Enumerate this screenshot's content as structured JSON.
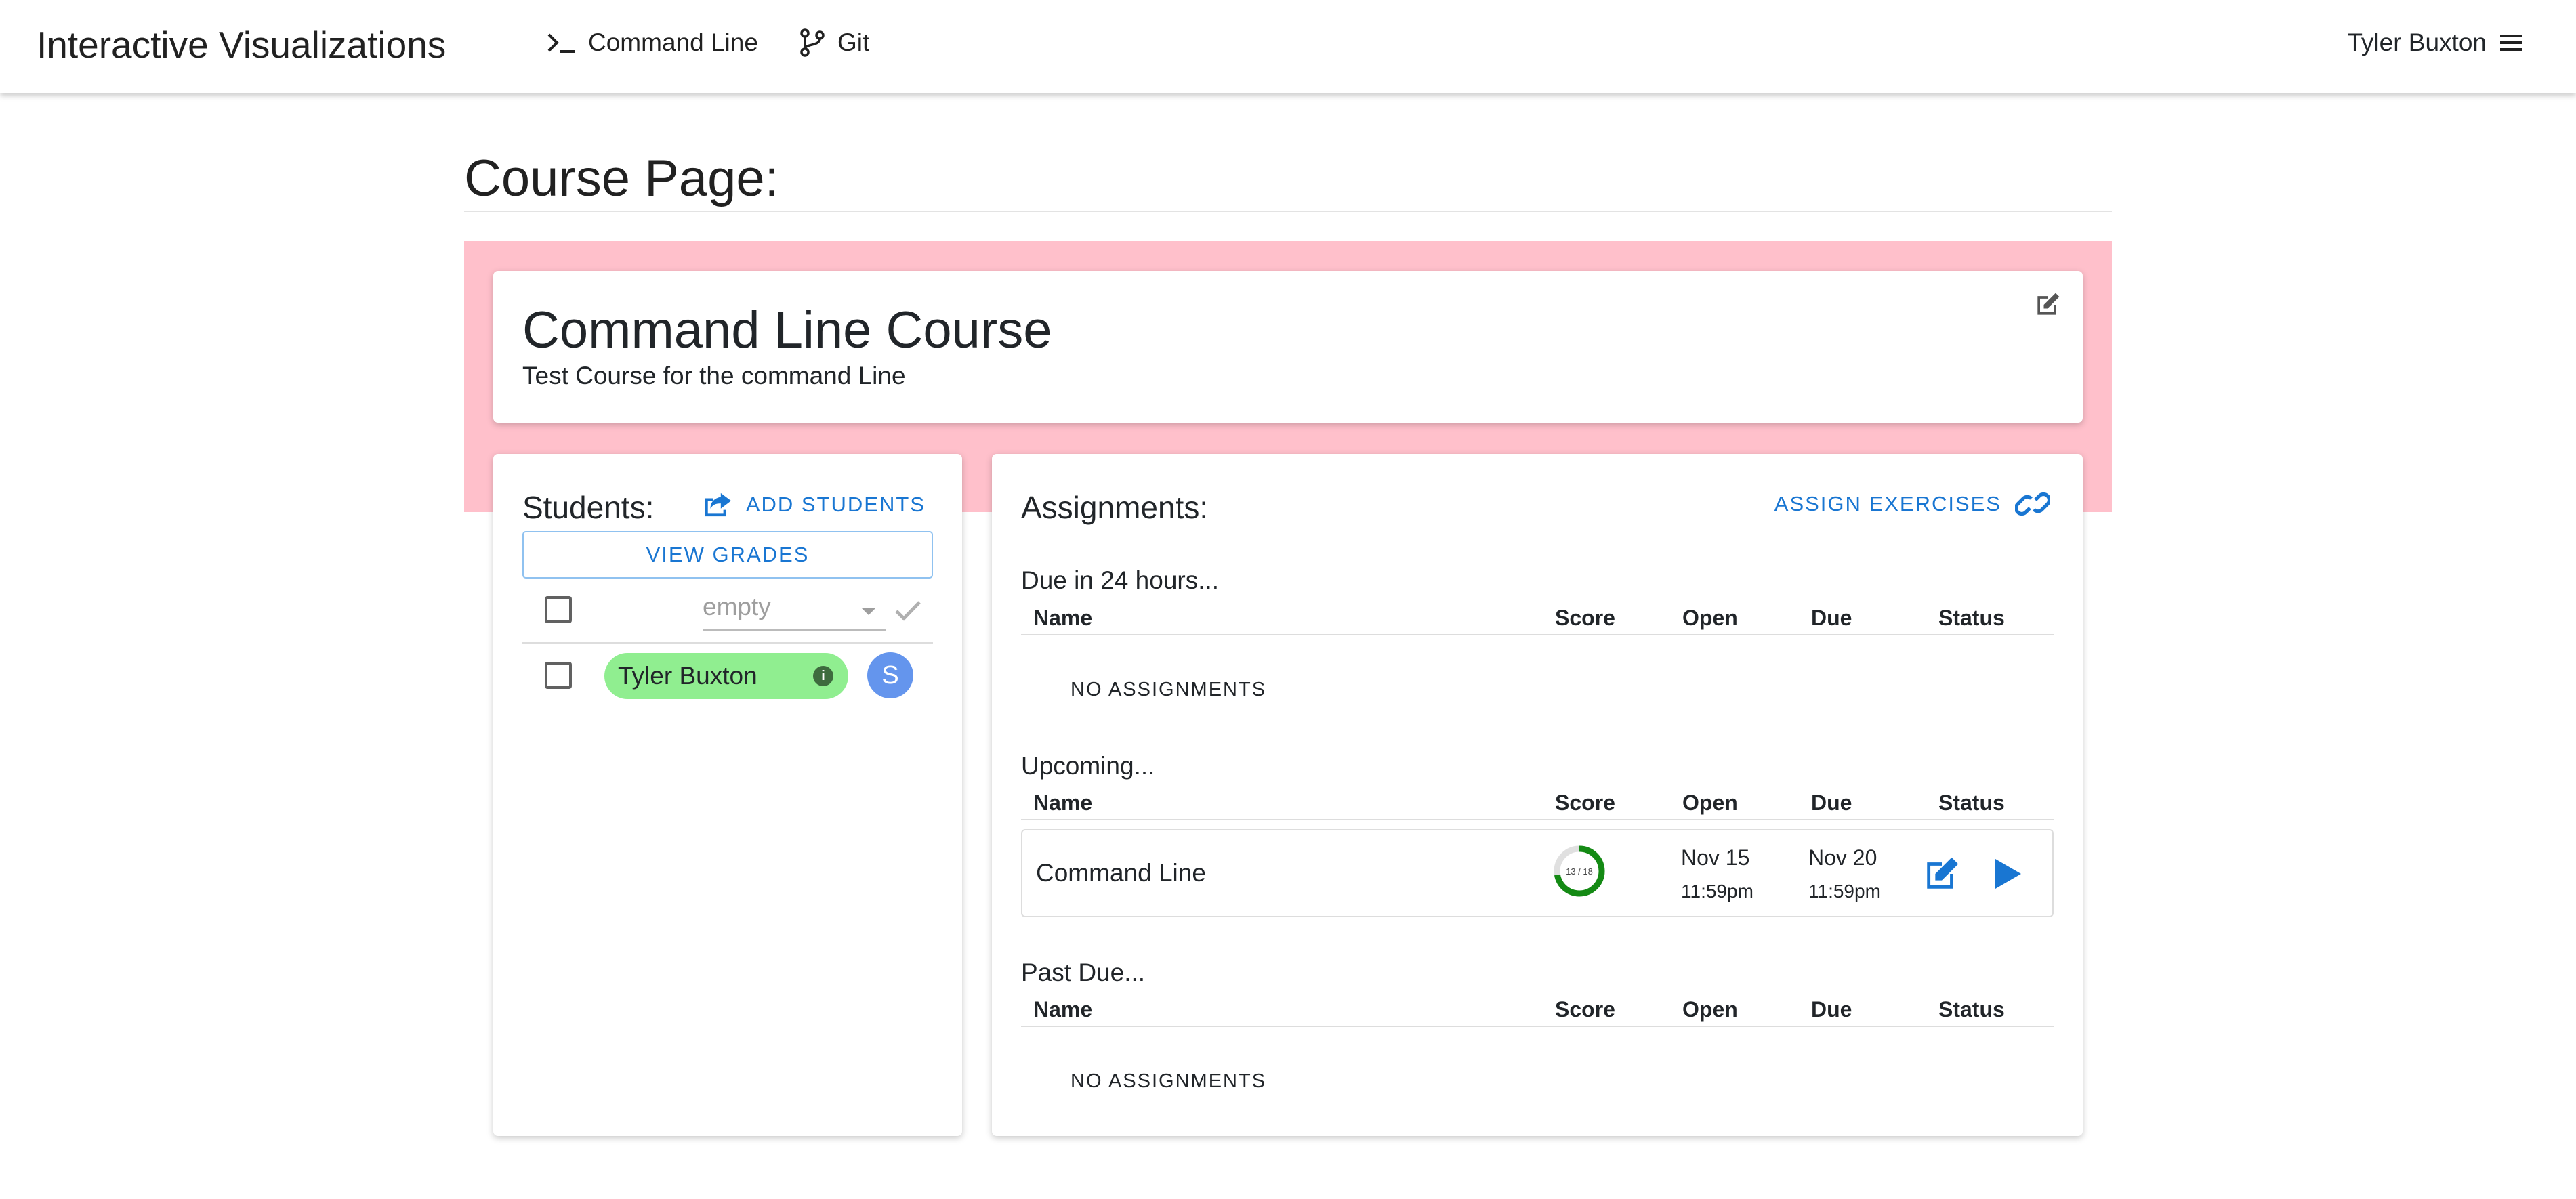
{
  "nav": {
    "brand": "Interactive Visualizations",
    "links": [
      {
        "label": "Command Line",
        "icon": "terminal-icon"
      },
      {
        "label": "Git",
        "icon": "git-branch-icon"
      }
    ],
    "user_name": "Tyler Buxton"
  },
  "page": {
    "title": "Course Page:"
  },
  "course": {
    "name": "Command Line Course",
    "description": "Test Course for the command Line",
    "banner_color": "#ffc0cb"
  },
  "students": {
    "heading": "Students:",
    "add_label": "ADD STUDENTS",
    "view_grades_label": "VIEW GRADES",
    "filter_placeholder": "empty",
    "list": [
      {
        "name": "Tyler Buxton",
        "avatar_letter": "S",
        "chip_color": "#90ee90",
        "avatar_color": "#6495ed"
      }
    ]
  },
  "assignments": {
    "heading": "Assignments:",
    "assign_label": "ASSIGN EXERCISES",
    "columns": [
      "Name",
      "Score",
      "Open",
      "Due",
      "Status"
    ],
    "sections": [
      {
        "title": "Due in 24 hours...",
        "empty_label": "NO ASSIGNMENTS"
      },
      {
        "title": "Upcoming...",
        "rows": [
          {
            "name": "Command Line",
            "score": "13 / 18",
            "score_fraction": 0.722,
            "open_date": "Nov 15",
            "open_time": "11:59pm",
            "due_date": "Nov 20",
            "due_time": "11:59pm"
          }
        ]
      },
      {
        "title": "Past Due...",
        "empty_label": "NO ASSIGNMENTS"
      }
    ]
  },
  "colors": {
    "accent": "#1976d2",
    "score_ring": "#148a14"
  }
}
